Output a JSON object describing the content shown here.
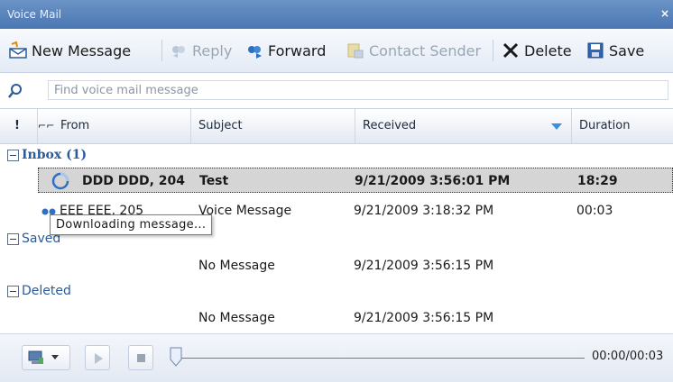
{
  "window": {
    "title": "Voice Mail",
    "close_glyph": "×"
  },
  "toolbar": {
    "new_message": "New Message",
    "reply": "Reply",
    "forward": "Forward",
    "contact_sender": "Contact Sender",
    "delete": "Delete",
    "save": "Save"
  },
  "search": {
    "placeholder": "Find voice mail message"
  },
  "columns": {
    "priority": "!",
    "type": "⌐⌐",
    "from": "From",
    "subject": "Subject",
    "received": "Received",
    "duration": "Duration"
  },
  "groups": {
    "inbox": {
      "label": "Inbox (1)"
    },
    "saved": {
      "label": "Saved"
    },
    "deleted": {
      "label": "Deleted"
    }
  },
  "rows": {
    "inbox": [
      {
        "from": "DDD DDD, 204",
        "subject": "Test",
        "received": "9/21/2009 3:56:01 PM",
        "duration": "18:29",
        "status": "downloading"
      },
      {
        "from": "EEE EEE, 205",
        "subject": "Voice Message",
        "received": "9/21/2009 3:18:32 PM",
        "duration": "00:03",
        "status": "unread"
      }
    ],
    "saved": [
      {
        "subject": "No Message",
        "received": "9/21/2009 3:56:15 PM"
      }
    ],
    "deleted": [
      {
        "subject": "No Message",
        "received": "9/21/2009 3:56:15 PM"
      }
    ]
  },
  "tooltip": {
    "text": "Downloading message..."
  },
  "player": {
    "time": "00:00/00:03",
    "progress": 0
  },
  "colors": {
    "title_bar": "#4a76b2",
    "group_text": "#2a5b9c",
    "sort_arrow": "#3c8ee0"
  }
}
